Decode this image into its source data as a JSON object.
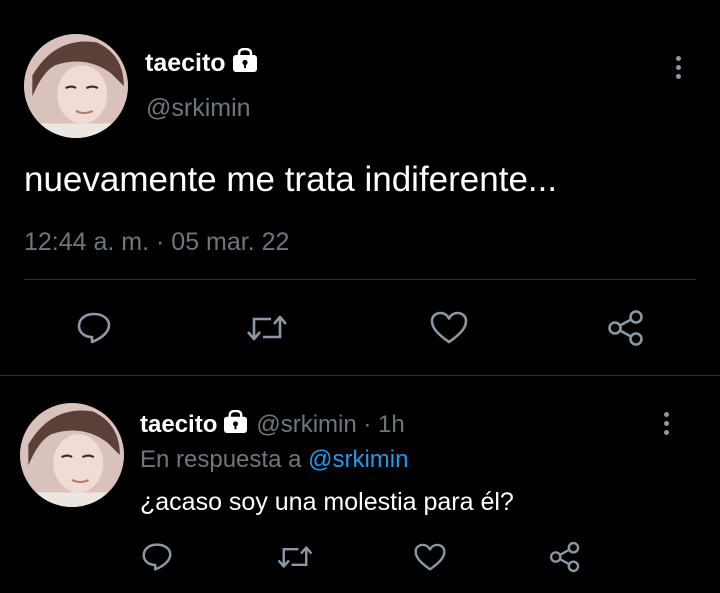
{
  "main_tweet": {
    "display_name": "taecito",
    "handle": "@srkimin",
    "text": "nuevamente me trata indiferente...",
    "timestamp": "12:44 a. m. · 05 mar. 22",
    "icons": [
      "lock-icon",
      "more-vertical-icon",
      "reply-icon",
      "retweet-icon",
      "like-icon",
      "share-icon"
    ]
  },
  "reply_tweet": {
    "display_name": "taecito",
    "handle_time": "@srkimin · 1h",
    "replying_prefix": "En respuesta a",
    "replying_to": "@srkimin",
    "text": "¿acaso soy una molestia para él?",
    "icons": [
      "lock-icon",
      "more-vertical-icon",
      "reply-icon",
      "retweet-icon",
      "like-icon",
      "share-icon"
    ]
  },
  "colors": {
    "background": "#000000",
    "text": "#ffffff",
    "muted": "#6e767d",
    "link": "#1d9bf0",
    "divider": "#2f3336"
  }
}
